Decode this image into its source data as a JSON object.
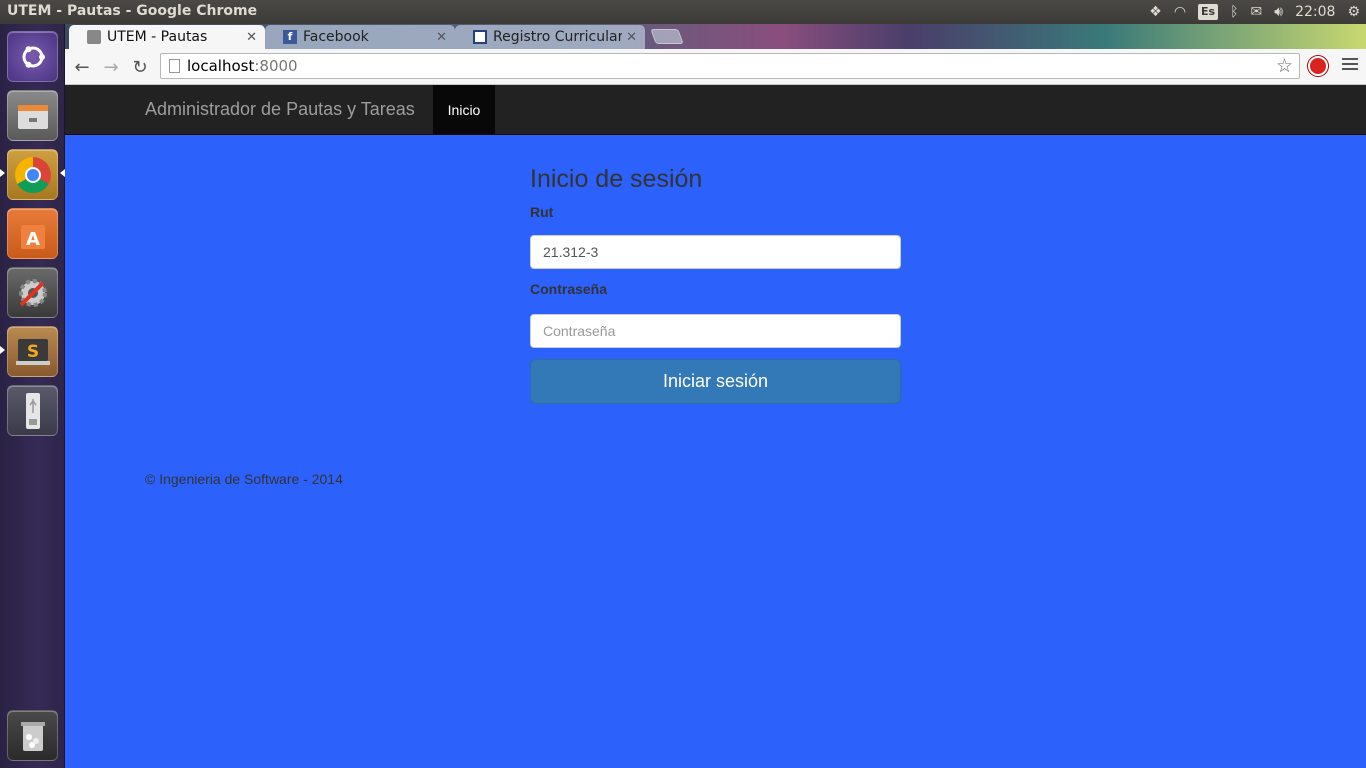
{
  "system": {
    "window_title": "UTEM - Pautas - Google Chrome",
    "keyboard_layout": "Es",
    "clock": "22:08",
    "indicators": [
      "dropbox-icon",
      "wifi-icon",
      "keyboard-icon",
      "bluetooth-icon",
      "mail-icon",
      "volume-icon",
      "gear-icon"
    ]
  },
  "launcher": {
    "items": [
      "ubuntu-dash",
      "files",
      "chrome",
      "software-center",
      "system-settings",
      "sublime-text",
      "usb-drive",
      "trash"
    ]
  },
  "browser": {
    "tabs": [
      {
        "label": "UTEM - Pautas",
        "active": true
      },
      {
        "label": "Facebook",
        "active": false
      },
      {
        "label": "Registro Curricular :",
        "active": false
      }
    ],
    "url": {
      "host": "localhost",
      "port": ":8000"
    }
  },
  "page": {
    "navbar": {
      "brand": "Administrador de Pautas y Tareas",
      "item": "Inicio"
    },
    "login": {
      "title": "Inicio de sesión",
      "rut_label": "Rut",
      "rut_value": "21.312-3",
      "password_label": "Contraseña",
      "password_placeholder": "Contraseña",
      "submit_label": "Iniciar sesión"
    },
    "footer": "© Ingenieria de Software - 2014"
  },
  "colors": {
    "page_background": "#2d61fb",
    "navbar": "#222222",
    "button": "#3379b8"
  }
}
